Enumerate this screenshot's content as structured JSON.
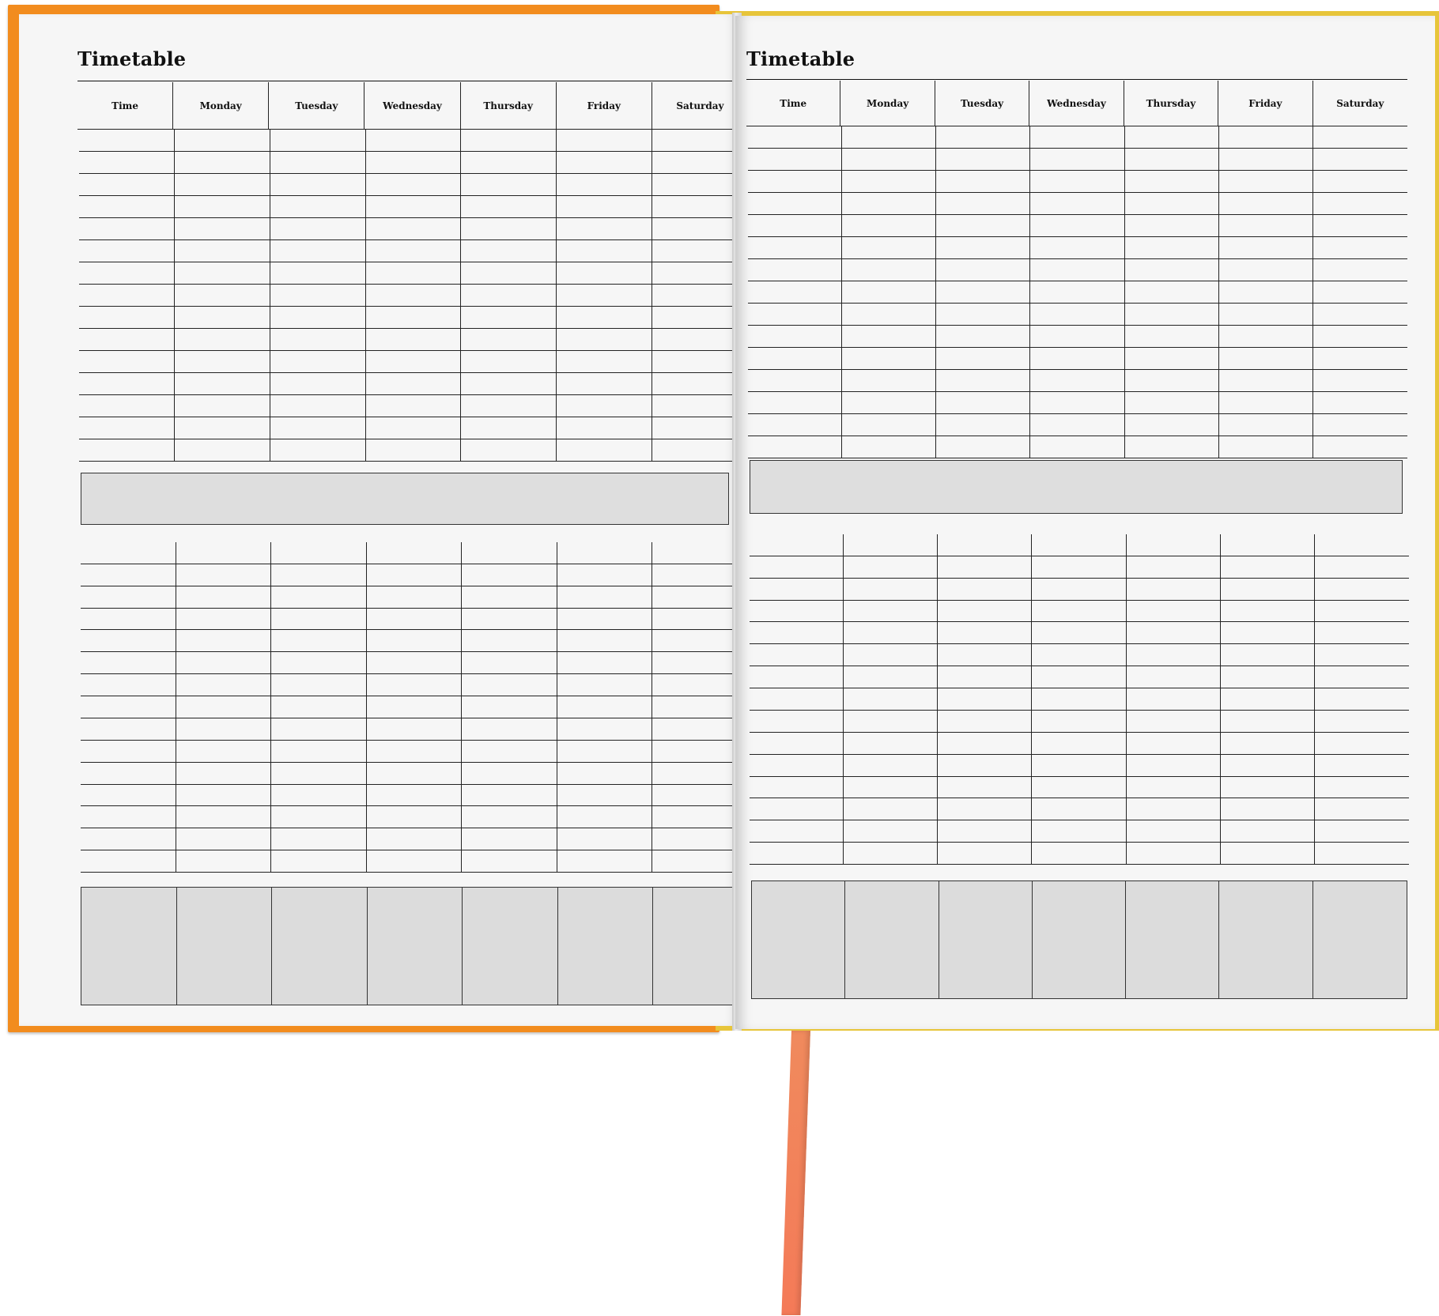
{
  "left_page": {
    "title": "Timetable",
    "columns": [
      "Time",
      "Monday",
      "Tuesday",
      "Wednesday",
      "Thursday",
      "Friday",
      "Saturday"
    ]
  },
  "right_page": {
    "title": "Timetable",
    "columns": [
      "Time",
      "Monday",
      "Tuesday",
      "Wednesday",
      "Thursday",
      "Friday",
      "Saturday"
    ]
  },
  "colors": {
    "cover": "#f28c1e",
    "ribbon": "#f47a58",
    "page": "#f6f6f6",
    "shaded_box": "#dedede"
  }
}
